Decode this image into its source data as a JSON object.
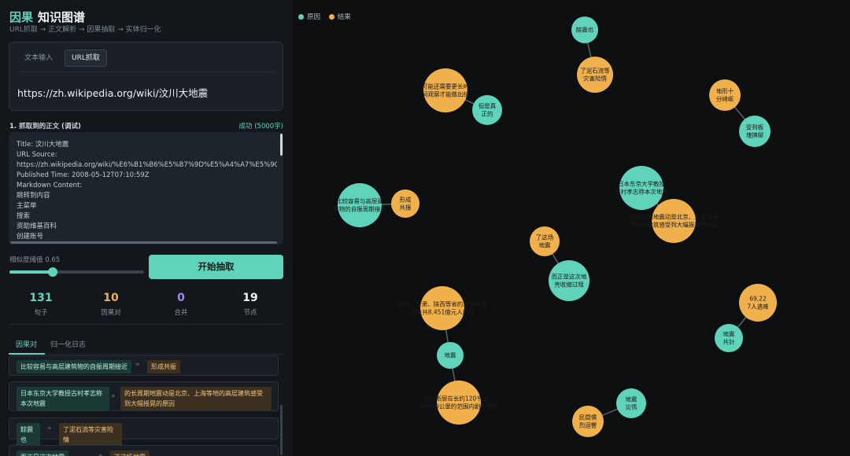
{
  "app": {
    "title_accent": "因果",
    "title_rest": "知识图谱",
    "subtitle": "URL抓取 → 正文解析 → 因果抽取 → 实体归一化"
  },
  "input": {
    "tab_text": "文本输入",
    "tab_url": "URL抓取",
    "url": "https://zh.wikipedia.org/wiki/汶川大地震"
  },
  "extract": {
    "label": "1. 抓取到的正文 (调试)",
    "status": "成功 (5000字)",
    "lines": [
      "Title: 汶川大地震",
      "URL Source:",
      "https://zh.wikipedia.org/wiki/%E6%B1%B6%E5%B7%9D%E5%A4%A7%E5%9C%B0%E9%9C%87",
      "Published Time: 2008-05-12T07:10:59Z",
      "Markdown Content:",
      "跳转到内容",
      "主菜单",
      "搜索",
      "资助维基百科",
      "创建账号"
    ]
  },
  "threshold": {
    "label": "相似度阈值",
    "value": "0.65",
    "fraction": 0.32
  },
  "start_button": "开始抽取",
  "stats": [
    {
      "value": "131",
      "label": "句子",
      "color": "#5fd4bb"
    },
    {
      "value": "10",
      "label": "因果对",
      "color": "#f0b04c"
    },
    {
      "value": "0",
      "label": "合并",
      "color": "#9b8cf2"
    },
    {
      "value": "19",
      "label": "节点",
      "color": "#eef2f5"
    }
  ],
  "result_tabs": {
    "pairs": "因果对",
    "log": "归一化日志"
  },
  "pairs": [
    {
      "cause": "比较容易与高层建筑物的自振周期接近",
      "effect": "形成共振"
    },
    {
      "cause": "日本东京大学教授古村孝志称本次地震",
      "effect": "的长周期地震动是北京、上海等地的高层建筑感受到大幅摇晃的原因"
    },
    {
      "cause": "餘震也",
      "effect": "了泥石流等灾害险情"
    },
    {
      "cause": "而正是这次地震",
      "effect": "了这场地震"
    }
  ],
  "legend": {
    "cause": "原因",
    "effect": "结果",
    "cause_color": "#5fd4bb",
    "effect_color": "#f0b04c"
  },
  "graph": {
    "nodes": [
      {
        "id": "n1",
        "type": "cause",
        "lines": [
          "餘震也"
        ]
      },
      {
        "id": "n2",
        "type": "effect",
        "lines": [
          "了泥石流等",
          "灾害险情"
        ]
      },
      {
        "id": "n3",
        "type": "effect",
        "lines": [
          "可能还需要更长时",
          "间观察才能做出结"
        ]
      },
      {
        "id": "n4",
        "type": "cause",
        "lines": [
          "但是真",
          "正的"
        ]
      },
      {
        "id": "n5",
        "type": "effect",
        "lines": [
          "地形十",
          "分崎岖"
        ]
      },
      {
        "id": "n6",
        "type": "cause",
        "lines": [
          "受到板",
          "塊擠壓"
        ]
      },
      {
        "id": "n7",
        "type": "cause",
        "lines": [
          "比较容易与高层建",
          "筑物的自振周期接近"
        ]
      },
      {
        "id": "n8",
        "type": "effect",
        "lines": [
          "形成",
          "共振"
        ]
      },
      {
        "id": "n9",
        "type": "cause",
        "lines": [
          "日本东京大学教授",
          "古村孝志称本次地震"
        ]
      },
      {
        "id": "n10",
        "type": "effect",
        "lines": [
          "的长周期地震动是北京、上海等地",
          "的高层建筑感受到大幅摇晃的原因"
        ]
      },
      {
        "id": "n11",
        "type": "effect",
        "lines": [
          "了这场",
          "地震"
        ]
      },
      {
        "id": "n12",
        "type": "cause",
        "lines": [
          "而正是这次地",
          "壳收缩过程"
        ]
      },
      {
        "id": "n13",
        "type": "effect",
        "lines": [
          "69,22",
          "7人遇难"
        ]
      },
      {
        "id": "n14",
        "type": "cause",
        "lines": [
          "地震",
          "共計"
        ]
      },
      {
        "id": "n15",
        "type": "effect",
        "lines": [
          "四川、甘肃、陕西等省的直接经济",
          "损失共8,451億元人民幣"
        ]
      },
      {
        "id": "n16",
        "type": "cause",
        "lines": [
          "地震"
        ]
      },
      {
        "id": "n17",
        "type": "effect",
        "lines": [
          "此次断层在长约120千米、",
          "宽约40公里的范围内剧烈滑动"
        ]
      },
      {
        "id": "n18",
        "type": "cause",
        "lines": [
          "地震",
          "災情"
        ]
      },
      {
        "id": "n19",
        "type": "effect",
        "lines": [
          "民間慣",
          "烈迴響"
        ]
      }
    ],
    "edges": [
      [
        "n1",
        "n2"
      ],
      [
        "n3",
        "n4"
      ],
      [
        "n5",
        "n6"
      ],
      [
        "n7",
        "n8"
      ],
      [
        "n9",
        "n10"
      ],
      [
        "n11",
        "n12"
      ],
      [
        "n13",
        "n14"
      ],
      [
        "n15",
        "n16"
      ],
      [
        "n16",
        "n17"
      ],
      [
        "n18",
        "n19"
      ]
    ]
  }
}
